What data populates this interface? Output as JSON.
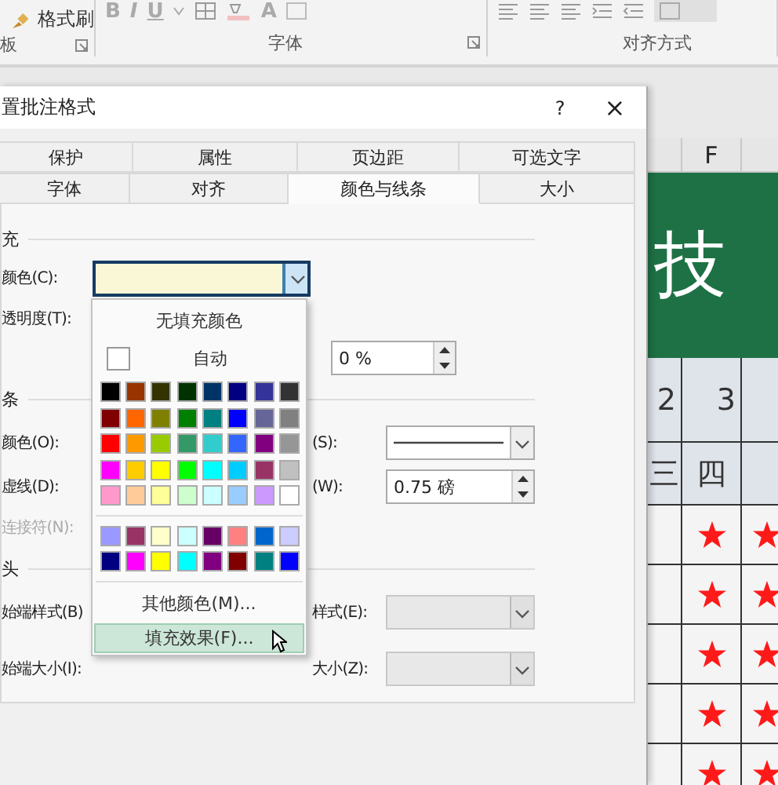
{
  "ribbon": {
    "format_painter": "格式刷",
    "font_buttons": [
      "B",
      "I",
      "U"
    ],
    "font_color_button": "A",
    "groups": [
      "板",
      "字体",
      "对齐方式"
    ]
  },
  "dialog": {
    "title": "置批注格式",
    "help": "?",
    "close": "×",
    "tabs_row_1": [
      {
        "label": "保护",
        "selected": false
      },
      {
        "label": "属性",
        "selected": false
      },
      {
        "label": "页边距",
        "selected": false
      },
      {
        "label": "可选文字",
        "selected": false
      }
    ],
    "tabs_row_2": [
      {
        "label": "字体",
        "selected": false
      },
      {
        "label": "对齐",
        "selected": false
      },
      {
        "label": "颜色与线条",
        "selected": true
      },
      {
        "label": "大小",
        "selected": false
      }
    ],
    "fill": {
      "heading": "充",
      "color_label": "颜色(C):",
      "color": "#faf7d6",
      "transparency_label": "透明度(T):",
      "transparency": "0 %"
    },
    "line": {
      "heading": "条",
      "color_label": "颜色(O):",
      "style_label": "(S):",
      "dash_label": "虚线(D):",
      "weight_label": "(W):",
      "weight": "0.75 磅",
      "connector_label": "连接符(N):",
      "connector_disabled": true
    },
    "arrows": {
      "heading": "头",
      "begin_style_label": "始端样式(B)",
      "end_style_label": "样式(E):",
      "begin_size_label": "始端大小(I):",
      "end_size_label": "大小(Z):",
      "disabled": true
    }
  },
  "color_menu": {
    "no_fill": "无填充颜色",
    "automatic": "自动",
    "standard_colors": [
      {
        "color": "#000000"
      },
      {
        "color": "#993300"
      },
      {
        "color": "#333300"
      },
      {
        "color": "#003300"
      },
      {
        "color": "#003366"
      },
      {
        "color": "#000080"
      },
      {
        "color": "#333399"
      },
      {
        "color": "#333333"
      },
      {
        "color": "#800000"
      },
      {
        "color": "#ff6600"
      },
      {
        "color": "#808000"
      },
      {
        "color": "#008000"
      },
      {
        "color": "#008080"
      },
      {
        "color": "#0000ff"
      },
      {
        "color": "#666699"
      },
      {
        "color": "#808080"
      },
      {
        "color": "#ff0000"
      },
      {
        "color": "#ff9900"
      },
      {
        "color": "#99cc00"
      },
      {
        "color": "#339966"
      },
      {
        "color": "#33cccc"
      },
      {
        "color": "#3366ff"
      },
      {
        "color": "#800080"
      },
      {
        "color": "#969696"
      },
      {
        "color": "#ff00ff"
      },
      {
        "color": "#ffcc00"
      },
      {
        "color": "#ffff00"
      },
      {
        "color": "#00ff00"
      },
      {
        "color": "#00ffff"
      },
      {
        "color": "#00ccff"
      },
      {
        "color": "#993366"
      },
      {
        "color": "#c0c0c0"
      },
      {
        "color": "#ff99cc"
      },
      {
        "color": "#ffcc99"
      },
      {
        "color": "#ffff99"
      },
      {
        "color": "#ccffcc"
      },
      {
        "color": "#ccffff"
      },
      {
        "color": "#99ccff"
      },
      {
        "color": "#cc99ff"
      },
      {
        "color": "#ffffff"
      }
    ],
    "extra_colors": [
      {
        "color": "#9999ff"
      },
      {
        "color": "#993366"
      },
      {
        "color": "#ffffcc"
      },
      {
        "color": "#ccffff"
      },
      {
        "color": "#660066"
      },
      {
        "color": "#ff8080"
      },
      {
        "color": "#0066cc"
      },
      {
        "color": "#ccccff"
      },
      {
        "color": "#000080"
      },
      {
        "color": "#ff00ff"
      },
      {
        "color": "#ffff00"
      },
      {
        "color": "#00ffff"
      },
      {
        "color": "#800080"
      },
      {
        "color": "#800000"
      },
      {
        "color": "#008080"
      },
      {
        "color": "#0000ff"
      }
    ],
    "more_colors": "其他颜色(M)...",
    "fill_effects": "填充效果(F)...",
    "fill_effects_highlighted": true
  },
  "sheet": {
    "column_header": "F",
    "banner": "技",
    "rows": [
      [
        "2",
        "3"
      ],
      [
        "三",
        "四"
      ]
    ],
    "star_rows": [
      {
        "cells": [
          {
            "kind": "empty"
          },
          {
            "kind": "star"
          },
          {
            "kind": "star"
          }
        ]
      },
      {
        "cells": [
          {
            "kind": "empty"
          },
          {
            "kind": "star"
          },
          {
            "kind": "star"
          }
        ]
      },
      {
        "cells": [
          {
            "kind": "empty"
          },
          {
            "kind": "star"
          },
          {
            "kind": "star"
          }
        ]
      },
      {
        "cells": [
          {
            "kind": "empty"
          },
          {
            "kind": "star"
          },
          {
            "kind": "star"
          }
        ]
      },
      {
        "cells": [
          {
            "kind": "empty"
          },
          {
            "kind": "star"
          },
          {
            "kind": "star"
          }
        ]
      }
    ]
  }
}
